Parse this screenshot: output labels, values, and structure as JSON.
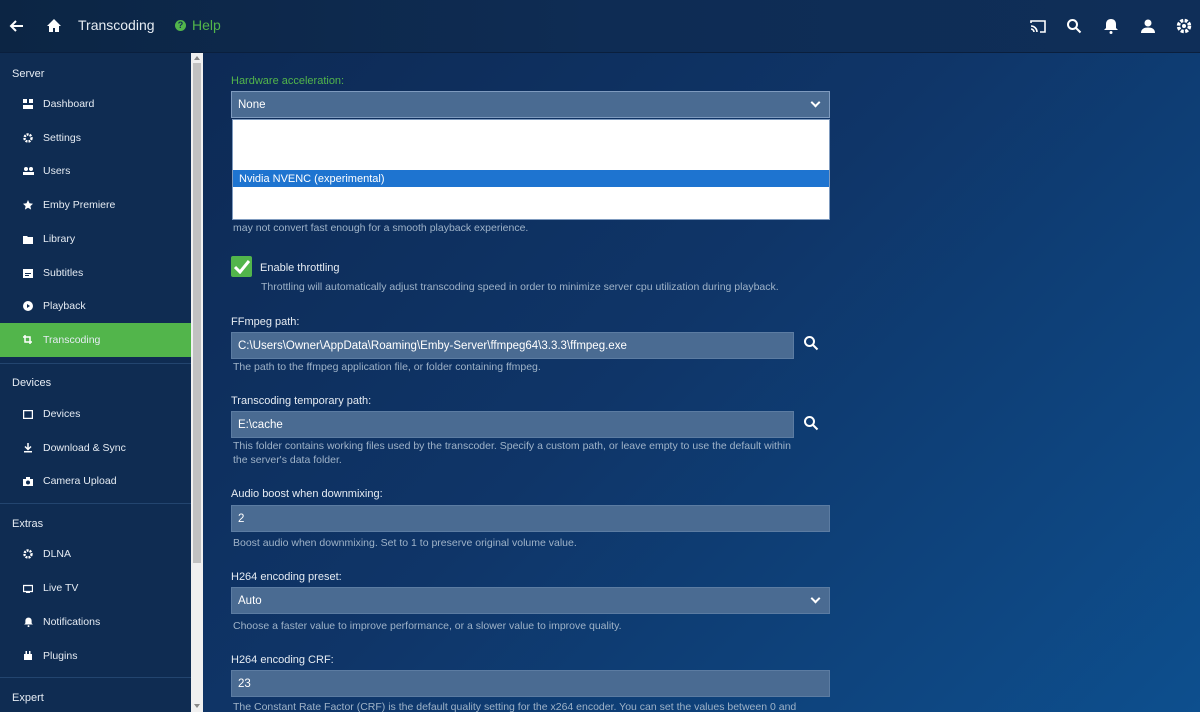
{
  "header": {
    "title": "Transcoding",
    "help_label": "Help",
    "help_glyph": "?"
  },
  "sidebar": {
    "sections": [
      {
        "heading": "Server"
      },
      {
        "heading": "Devices"
      },
      {
        "heading": "Extras"
      },
      {
        "heading": "Expert"
      }
    ],
    "items": [
      {
        "label": "Dashboard",
        "icon": "dashboard-icon"
      },
      {
        "label": "Settings",
        "icon": "gear-icon"
      },
      {
        "label": "Users",
        "icon": "users-icon"
      },
      {
        "label": "Emby Premiere",
        "icon": "star-icon"
      },
      {
        "label": "Library",
        "icon": "folder-icon"
      },
      {
        "label": "Subtitles",
        "icon": "subtitles-icon"
      },
      {
        "label": "Playback",
        "icon": "play-circle-icon"
      },
      {
        "label": "Transcoding",
        "icon": "transcode-icon",
        "active": true
      },
      {
        "label": "Devices",
        "icon": "tablet-icon"
      },
      {
        "label": "Download & Sync",
        "icon": "download-icon"
      },
      {
        "label": "Camera Upload",
        "icon": "camera-icon"
      },
      {
        "label": "DLNA",
        "icon": "gear-icon"
      },
      {
        "label": "Live TV",
        "icon": "tv-icon"
      },
      {
        "label": "Notifications",
        "icon": "bell-icon"
      },
      {
        "label": "Plugins",
        "icon": "plugin-icon"
      }
    ]
  },
  "form": {
    "hw_accel": {
      "label": "Hardware acceleration:",
      "value": "None",
      "options": [
        "",
        "",
        "",
        "Nvidia NVENC (experimental)",
        "",
        ""
      ],
      "selected_option": "Nvidia NVENC (experimental)",
      "hint_tail": "may not convert fast enough for a smooth playback experience."
    },
    "throttling": {
      "label": "Enable throttling",
      "checked": true,
      "hint": "Throttling will automatically adjust transcoding speed in order to minimize server cpu utilization during playback."
    },
    "ffmpeg_path": {
      "label": "FFmpeg path:",
      "value": "C:\\Users\\Owner\\AppData\\Roaming\\Emby-Server\\ffmpeg64\\3.3.3\\ffmpeg.exe",
      "hint": "The path to the ffmpeg application file, or folder containing ffmpeg."
    },
    "temp_path": {
      "label": "Transcoding temporary path:",
      "value": "E:\\cache",
      "hint_line1": "This folder contains working files used by the transcoder. Specify a custom path, or leave empty to use the default within",
      "hint_line2": "the server's data folder."
    },
    "audio_boost": {
      "label": "Audio boost when downmixing:",
      "value": "2",
      "hint": "Boost audio when downmixing. Set to 1 to preserve original volume value."
    },
    "h264_preset": {
      "label": "H264 encoding preset:",
      "value": "Auto",
      "hint": "Choose a faster value to improve performance, or a slower value to improve quality."
    },
    "h264_crf": {
      "label": "H264 encoding CRF:",
      "value": "23",
      "hint": "The Constant Rate Factor (CRF) is the default quality setting for the x264 encoder. You can set the values between 0 and"
    }
  },
  "colors": {
    "accent": "#52b54b",
    "selection": "#1e74d0"
  }
}
